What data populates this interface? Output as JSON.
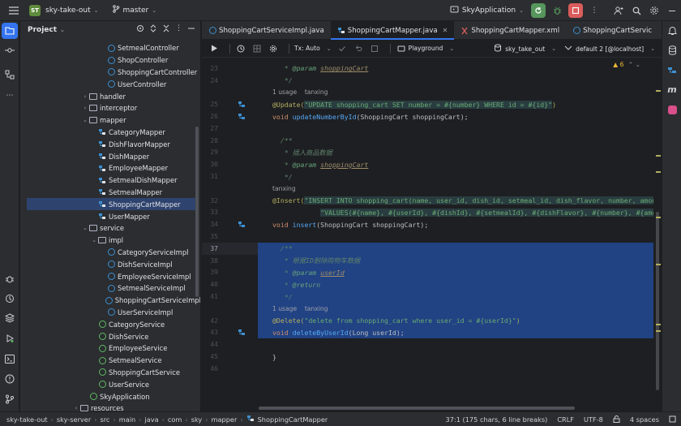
{
  "titlebar": {
    "project_badge": "ST",
    "project_name": "sky-take-out",
    "branch": "master",
    "run_config": "SkyApplication"
  },
  "project_panel": {
    "title": "Project",
    "tree": [
      {
        "label": "SetmealController",
        "indent": 5,
        "icon": "class",
        "arrow": ""
      },
      {
        "label": "ShopController",
        "indent": 5,
        "icon": "class",
        "arrow": ""
      },
      {
        "label": "ShoppingCartController",
        "indent": 5,
        "icon": "class",
        "arrow": ""
      },
      {
        "label": "UserController",
        "indent": 5,
        "icon": "class",
        "arrow": ""
      },
      {
        "label": "handler",
        "indent": 3,
        "icon": "folder",
        "arrow": "›"
      },
      {
        "label": "interceptor",
        "indent": 3,
        "icon": "folder",
        "arrow": "›"
      },
      {
        "label": "mapper",
        "indent": 3,
        "icon": "folder",
        "arrow": "⌄"
      },
      {
        "label": "CategoryMapper",
        "indent": 4,
        "icon": "mapper",
        "arrow": ""
      },
      {
        "label": "DishFlavorMapper",
        "indent": 4,
        "icon": "mapper",
        "arrow": ""
      },
      {
        "label": "DishMapper",
        "indent": 4,
        "icon": "mapper",
        "arrow": ""
      },
      {
        "label": "EmployeeMapper",
        "indent": 4,
        "icon": "mapper",
        "arrow": ""
      },
      {
        "label": "SetmealDishMapper",
        "indent": 4,
        "icon": "mapper",
        "arrow": ""
      },
      {
        "label": "SetmealMapper",
        "indent": 4,
        "icon": "mapper",
        "arrow": ""
      },
      {
        "label": "ShoppingCartMapper",
        "indent": 4,
        "icon": "mapper",
        "arrow": "",
        "selected": true
      },
      {
        "label": "UserMapper",
        "indent": 4,
        "icon": "mapper",
        "arrow": ""
      },
      {
        "label": "service",
        "indent": 3,
        "icon": "folder",
        "arrow": "⌄"
      },
      {
        "label": "impl",
        "indent": 4,
        "icon": "folder",
        "arrow": "⌄"
      },
      {
        "label": "CategoryServiceImpl",
        "indent": 5,
        "icon": "class",
        "arrow": ""
      },
      {
        "label": "DishServiceImpl",
        "indent": 5,
        "icon": "class",
        "arrow": ""
      },
      {
        "label": "EmployeeServiceImpl",
        "indent": 5,
        "icon": "class",
        "arrow": ""
      },
      {
        "label": "SetmealServiceImpl",
        "indent": 5,
        "icon": "class",
        "arrow": ""
      },
      {
        "label": "ShoppingCartServiceImpl",
        "indent": 5,
        "icon": "class",
        "arrow": ""
      },
      {
        "label": "UserServiceImpl",
        "indent": 5,
        "icon": "class",
        "arrow": ""
      },
      {
        "label": "CategoryService",
        "indent": 4,
        "icon": "interface",
        "arrow": ""
      },
      {
        "label": "DishService",
        "indent": 4,
        "icon": "interface",
        "arrow": ""
      },
      {
        "label": "EmployeeService",
        "indent": 4,
        "icon": "interface",
        "arrow": ""
      },
      {
        "label": "SetmealService",
        "indent": 4,
        "icon": "interface",
        "arrow": ""
      },
      {
        "label": "ShoppingCartService",
        "indent": 4,
        "icon": "interface",
        "arrow": ""
      },
      {
        "label": "UserService",
        "indent": 4,
        "icon": "interface",
        "arrow": ""
      },
      {
        "label": "SkyApplication",
        "indent": 3,
        "icon": "app",
        "arrow": ""
      },
      {
        "label": "resources",
        "indent": 2,
        "icon": "folder",
        "arrow": "›"
      }
    ]
  },
  "tabs": [
    {
      "label": "ShoppingCartServiceImpl.java",
      "icon": "class",
      "active": false
    },
    {
      "label": "ShoppingCartMapper.java",
      "icon": "mapper",
      "active": true
    },
    {
      "label": "ShoppingCartMapper.xml",
      "icon": "xml",
      "active": false
    },
    {
      "label": "ShoppingCartServic",
      "icon": "class",
      "active": false
    }
  ],
  "editor_toolbar": {
    "tx_mode": "Tx: Auto",
    "playground": "Playground",
    "datasource": "sky_take_out",
    "schema": "default 2 [@localhost]",
    "warnings": "6"
  },
  "code_lines": [
    {
      "n": "23",
      "tokens": [
        [
          "c-doc",
          "   * "
        ],
        [
          "c-tag",
          "@param "
        ],
        [
          "c-tagv",
          "shoppingCart"
        ]
      ]
    },
    {
      "n": "24",
      "tokens": [
        [
          "c-doc",
          "   */"
        ]
      ]
    },
    {
      "n": "",
      "hint": "1 usage    tanxing"
    },
    {
      "n": "25",
      "gutter": "mybatis",
      "tokens": [
        [
          "c-ann",
          "@Update("
        ],
        [
          "c-str c-sqlbg",
          "\"UPDATE shopping_cart SET number = #{number} WHERE id = #{id}\""
        ],
        [
          "c-ann",
          ")"
        ]
      ]
    },
    {
      "n": "26",
      "gutter": "mybatis",
      "tokens": [
        [
          "c-kw",
          "void "
        ],
        [
          "c-fn",
          "updateNumberById"
        ],
        [
          "",
          "(ShoppingCart shoppingCart);"
        ]
      ]
    },
    {
      "n": "27",
      "tokens": []
    },
    {
      "n": "28",
      "tokens": [
        [
          "c-doc",
          "  /**"
        ]
      ]
    },
    {
      "n": "29",
      "tokens": [
        [
          "c-doc",
          "   * 插入商品数据"
        ]
      ]
    },
    {
      "n": "30",
      "tokens": [
        [
          "c-doc",
          "   * "
        ],
        [
          "c-tag",
          "@param "
        ],
        [
          "c-tagv",
          "shoppingCart"
        ]
      ]
    },
    {
      "n": "31",
      "tokens": [
        [
          "c-doc",
          "   */"
        ]
      ]
    },
    {
      "n": "",
      "hint": "tanxing"
    },
    {
      "n": "32",
      "tokens": [
        [
          "c-ann",
          "@Insert("
        ],
        [
          "c-str c-sqlbg",
          "\"INSERT INTO shopping_cart(name, user_id, dish_id, setmeal_id, dish_flavor, number, amount, imag"
        ]
      ]
    },
    {
      "n": "33",
      "tokens": [
        [
          "",
          "            "
        ],
        [
          "c-str c-sqlbg",
          "\"VALUES(#{name}, #{userId}, #{dishId}, #{setmealId}, #{dishFlavor}, #{number}, #{amount}, #{imag"
        ]
      ]
    },
    {
      "n": "34",
      "gutter": "mybatis",
      "tokens": [
        [
          "c-kw",
          "void "
        ],
        [
          "c-fn",
          "insert"
        ],
        [
          "",
          "(ShoppingCart shoppingCart);"
        ]
      ]
    },
    {
      "n": "35",
      "tokens": []
    },
    {
      "n": "37",
      "tokens": [
        [
          "c-doc",
          "  /**"
        ]
      ],
      "selected": true,
      "current": true
    },
    {
      "n": "38",
      "tokens": [
        [
          "c-doc",
          "   * 根据ID删除购物车数据"
        ]
      ],
      "selected": true
    },
    {
      "n": "39",
      "tokens": [
        [
          "c-doc",
          "   * "
        ],
        [
          "c-tag",
          "@param "
        ],
        [
          "c-tagv",
          "userId"
        ]
      ],
      "selected": true
    },
    {
      "n": "40",
      "tokens": [
        [
          "c-doc",
          "   * "
        ],
        [
          "c-tag",
          "@return"
        ]
      ],
      "selected": true
    },
    {
      "n": "41",
      "tokens": [
        [
          "c-doc",
          "   */"
        ]
      ],
      "selected": true
    },
    {
      "n": "",
      "hint": "1 usage    tanxing",
      "selected": true
    },
    {
      "n": "42",
      "tokens": [
        [
          "c-ann",
          "@Delete("
        ],
        [
          "c-str",
          "\"delete from shopping_cart where user_id = #{userId}\""
        ],
        [
          "c-ann",
          ")"
        ]
      ],
      "selected": true
    },
    {
      "n": "43",
      "gutter": "mybatis",
      "tokens": [
        [
          "c-kw",
          "void "
        ],
        [
          "c-fn",
          "deleteByUserId"
        ],
        [
          "",
          "(Long userId);"
        ]
      ],
      "selected": true
    },
    {
      "n": "44",
      "tokens": []
    },
    {
      "n": "45",
      "tokens": [
        [
          "",
          "}"
        ]
      ],
      "brace": true
    },
    {
      "n": "46",
      "tokens": []
    }
  ],
  "statusbar": {
    "breadcrumb": [
      "sky-take-out",
      "sky-server",
      "src",
      "main",
      "java",
      "com",
      "sky",
      "mapper",
      "ShoppingCartMapper"
    ],
    "selection": "37:1 (175 chars, 6 line breaks)",
    "line_sep": "CRLF",
    "encoding": "UTF-8",
    "indent": "4 spaces"
  },
  "colors": {
    "accent": "#3574f0",
    "run": "#57965c",
    "stop": "#db5c5c"
  }
}
